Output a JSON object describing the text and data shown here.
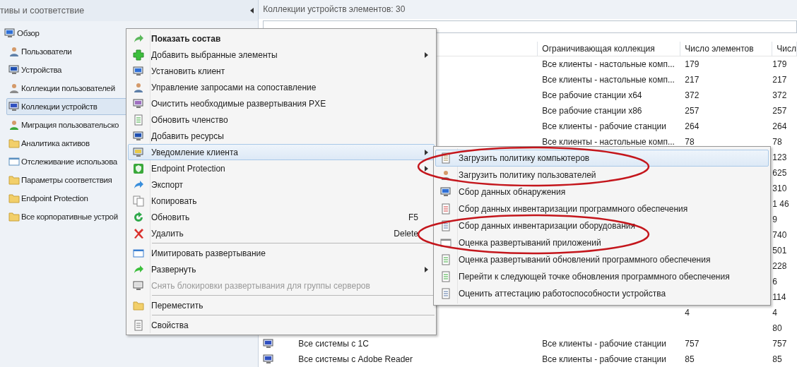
{
  "nav": {
    "header": "тивы и соответствие",
    "tree": [
      {
        "label": "Обзор",
        "selected": false,
        "children": [
          {
            "label": "Пользователи",
            "selected": false
          },
          {
            "label": "Устройства",
            "selected": false
          },
          {
            "label": "Коллекции пользователей",
            "selected": false
          },
          {
            "label": "Коллекции устройств",
            "selected": true
          },
          {
            "label": "Миграция пользовательско",
            "selected": false
          },
          {
            "label": "Аналитика активов",
            "selected": false
          },
          {
            "label": "Отслеживание использова",
            "selected": false
          },
          {
            "label": "Параметры соответствия",
            "selected": false
          },
          {
            "label": "Endpoint Protection",
            "selected": false
          },
          {
            "label": "Все корпоративные устрой",
            "selected": false
          }
        ]
      }
    ]
  },
  "main": {
    "title": "Коллекции устройств элементов: 30",
    "table": {
      "columns": [
        "Ограничивающая коллекция",
        "Число элементов",
        "Числ"
      ],
      "rows": [
        {
          "limiting": "Все клиенты - настольные комп...",
          "count": "179",
          "column_5": "179"
        },
        {
          "limiting": "Все клиенты - настольные комп...",
          "count": "217",
          "column_5": "217"
        },
        {
          "limiting": "Все рабочие станции x64",
          "count": "372",
          "column_5": "372"
        },
        {
          "limiting": "Все рабочие станции x86",
          "count": "257",
          "column_5": "257"
        },
        {
          "limiting": "Все клиенты - рабочие станции",
          "count": "264",
          "column_5": "264"
        },
        {
          "limiting": "Все клиенты - настольные комп...",
          "count": "78",
          "column_5": "78"
        },
        {
          "column_5": "123"
        },
        {
          "column_5": "625"
        },
        {
          "column_5": "310"
        },
        {
          "column_5": "1 46"
        },
        {
          "column_5": "9"
        },
        {
          "column_5": "740"
        },
        {
          "column_5": "501"
        },
        {
          "column_5": "228"
        },
        {
          "column_5": "6"
        },
        {
          "column_5": "114"
        },
        {
          "count": "4",
          "column_5": "4"
        },
        {
          "column_5": "80"
        },
        {
          "name": "Все системы с 1С",
          "limiting": "Все клиенты - рабочие станции",
          "count": "757",
          "column_5": "757"
        },
        {
          "name": "Все системы с Adobe Reader",
          "limiting": "Все клиенты - рабочие станции",
          "count": "85",
          "column_5": "85"
        }
      ]
    }
  },
  "context_menu": {
    "items": [
      {
        "kind": "item",
        "label": "Показать состав",
        "default": true,
        "selected": false
      },
      {
        "kind": "item",
        "label": "Добавить выбранные элементы",
        "submenu": true,
        "selected": false
      },
      {
        "kind": "item",
        "label": "Установить клиент",
        "selected": false
      },
      {
        "kind": "item",
        "label": "Управление запросами на сопоставление",
        "selected": false
      },
      {
        "kind": "item",
        "label": "Очистить необходимые развертывания PXE",
        "selected": false
      },
      {
        "kind": "item",
        "label": "Обновить членство",
        "selected": false
      },
      {
        "kind": "item",
        "label": "Добавить ресурсы",
        "selected": false
      },
      {
        "kind": "item",
        "label": "Уведомление клиента",
        "submenu": true,
        "selected": true
      },
      {
        "kind": "item",
        "label": "Endpoint Protection",
        "submenu": true,
        "selected": false
      },
      {
        "kind": "item",
        "label": "Экспорт",
        "selected": false
      },
      {
        "kind": "item",
        "label": "Копировать",
        "selected": false
      },
      {
        "kind": "item",
        "label": "Обновить",
        "shortcut": "F5",
        "selected": false
      },
      {
        "kind": "item",
        "label": "Удалить",
        "shortcut": "Delete",
        "selected": false
      },
      {
        "kind": "separator"
      },
      {
        "kind": "item",
        "label": "Имитировать развертывание",
        "selected": false
      },
      {
        "kind": "item",
        "label": "Развернуть",
        "submenu": true,
        "selected": false
      },
      {
        "kind": "item",
        "label": "Снять блокировки развертывания для группы серверов",
        "disabled": true,
        "selected": false
      },
      {
        "kind": "separator"
      },
      {
        "kind": "item",
        "label": "Переместить",
        "selected": false
      },
      {
        "kind": "separator"
      },
      {
        "kind": "item",
        "label": "Свойства",
        "selected": false
      }
    ]
  },
  "submenu": {
    "items": [
      {
        "label": "Загрузить политику компьютеров",
        "selected": true,
        "circled": true
      },
      {
        "label": "Загрузить политику пользователей",
        "selected": false,
        "circled": true
      },
      {
        "label": "Сбор данных обнаружения",
        "selected": false,
        "circled": false
      },
      {
        "label": "Сбор данных инвентаризации программного обеспечения",
        "selected": false,
        "circled": false
      },
      {
        "label": "Сбор данных инвентаризации оборудования",
        "selected": false,
        "circled": true
      },
      {
        "label": "Оценка развертываний приложений",
        "selected": false,
        "circled": true
      },
      {
        "label": "Оценка развертываний обновлений программного обеспечения",
        "selected": false,
        "circled": false
      },
      {
        "label": "Перейти к следующей точке обновления программного обеспечения",
        "selected": false,
        "circled": false
      },
      {
        "label": "Оценить аттестацию работоспособности устройства",
        "selected": false,
        "circled": false
      }
    ]
  }
}
